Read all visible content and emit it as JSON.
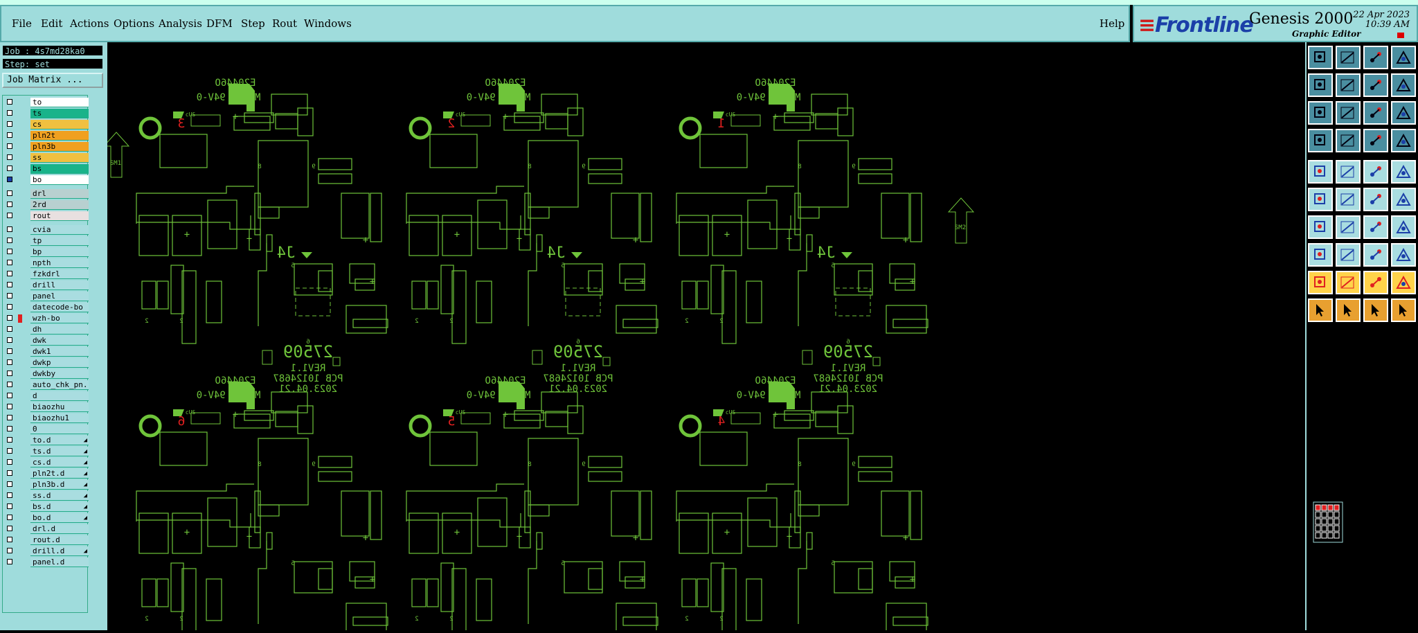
{
  "menus": [
    "File",
    "Edit",
    "Actions",
    "Options",
    "Analysis",
    "DFM",
    "Step",
    "Rout",
    "Windows"
  ],
  "help": "Help",
  "brand": {
    "logo": "Frontline",
    "product": "Genesis 2000",
    "sub": "Graphic Editor",
    "date": "22 Apr 2023",
    "time": "10:39 AM"
  },
  "job": {
    "job_label": "Job : 4s7md28ka0",
    "step_label": "Step: set",
    "matrix_button": "Job Matrix ..."
  },
  "layers": [
    {
      "name": "to",
      "color": "#ffffff"
    },
    {
      "name": "ts",
      "color": "#19b38a"
    },
    {
      "name": "cs",
      "color": "#f0c040"
    },
    {
      "name": "pln2t",
      "color": "#f0a020"
    },
    {
      "name": "pln3b",
      "color": "#f0a020"
    },
    {
      "name": "ss",
      "color": "#f0c040"
    },
    {
      "name": "bs",
      "color": "#19b38a"
    },
    {
      "name": "bo",
      "color": "#ffffff"
    },
    {
      "name": "drl",
      "color": "#b8d0d0"
    },
    {
      "name": "2rd",
      "color": "#b8d0d0"
    },
    {
      "name": "rout",
      "color": "#e8e0e0"
    },
    {
      "name": "cvia",
      "color": "#a9dde0"
    },
    {
      "name": "tp",
      "color": "#a9dde0"
    },
    {
      "name": "bp",
      "color": "#a9dde0"
    },
    {
      "name": "npth",
      "color": "#a9dde0"
    },
    {
      "name": "fzkdrl",
      "color": "#a9dde0"
    },
    {
      "name": "drill",
      "color": "#a9dde0"
    },
    {
      "name": "panel",
      "color": "#a9dde0"
    },
    {
      "name": "datecode-bo",
      "color": "#a9dde0"
    },
    {
      "name": "wzh-bo",
      "color": "#a9dde0"
    },
    {
      "name": "dh",
      "color": "#a9dde0"
    },
    {
      "name": "dwk",
      "color": "#a9dde0"
    },
    {
      "name": "dwk1",
      "color": "#a9dde0"
    },
    {
      "name": "dwkp",
      "color": "#a9dde0"
    },
    {
      "name": "dwkby",
      "color": "#a9dde0"
    },
    {
      "name": "auto_chk_pn.",
      "color": "#a9dde0"
    },
    {
      "name": "d",
      "color": "#a9dde0"
    },
    {
      "name": "biaozhu",
      "color": "#a9dde0"
    },
    {
      "name": "biaozhu1",
      "color": "#a9dde0"
    },
    {
      "name": "0",
      "color": "#a9dde0"
    },
    {
      "name": "to.d",
      "color": "#a9dde0"
    },
    {
      "name": "ts.d",
      "color": "#a9dde0"
    },
    {
      "name": "cs.d",
      "color": "#a9dde0"
    },
    {
      "name": "pln2t.d",
      "color": "#a9dde0"
    },
    {
      "name": "pln3b.d",
      "color": "#a9dde0"
    },
    {
      "name": "ss.d",
      "color": "#a9dde0"
    },
    {
      "name": "bs.d",
      "color": "#a9dde0"
    },
    {
      "name": "bo.d",
      "color": "#a9dde0"
    },
    {
      "name": "drl.d",
      "color": "#a9dde0"
    },
    {
      "name": "rout.d",
      "color": "#a9dde0"
    },
    {
      "name": "drill.d",
      "color": "#a9dde0"
    },
    {
      "name": "panel.d",
      "color": "#a9dde0"
    }
  ],
  "boards": [
    {
      "num": "3",
      "text1": "E20446O",
      "text2": "MI1 S 94V-0",
      "text3": "27509",
      "text4": "REV1.1",
      "text5": "PCB 10124687",
      "text6": "2023.04.21",
      "text7": "J4"
    },
    {
      "num": "2",
      "text1": "E20446O",
      "text2": "MI1 S 94V-0",
      "text3": "27509",
      "text4": "REV1.1",
      "text5": "PCB 10124687",
      "text6": "2023.04.21",
      "text7": "J4"
    },
    {
      "num": "1",
      "text1": "E20446O",
      "text2": "MI1 S 94V-0",
      "text3": "27509",
      "text4": "REV1.1",
      "text5": "PCB 10124687",
      "text6": "2023.04.21",
      "text7": "J4"
    },
    {
      "num": "6",
      "text1": "E20446O",
      "text2": "MI1 S 94V-0"
    },
    {
      "num": "5",
      "text1": "E20446O",
      "text2": "MI1 S 94V-0"
    },
    {
      "num": "4",
      "text1": "E20446O",
      "text2": "MI1 S 94V-0"
    }
  ],
  "colors": {
    "trace": "#6fc43a",
    "accent": "#e02020",
    "panel": "#9fdcdc"
  }
}
